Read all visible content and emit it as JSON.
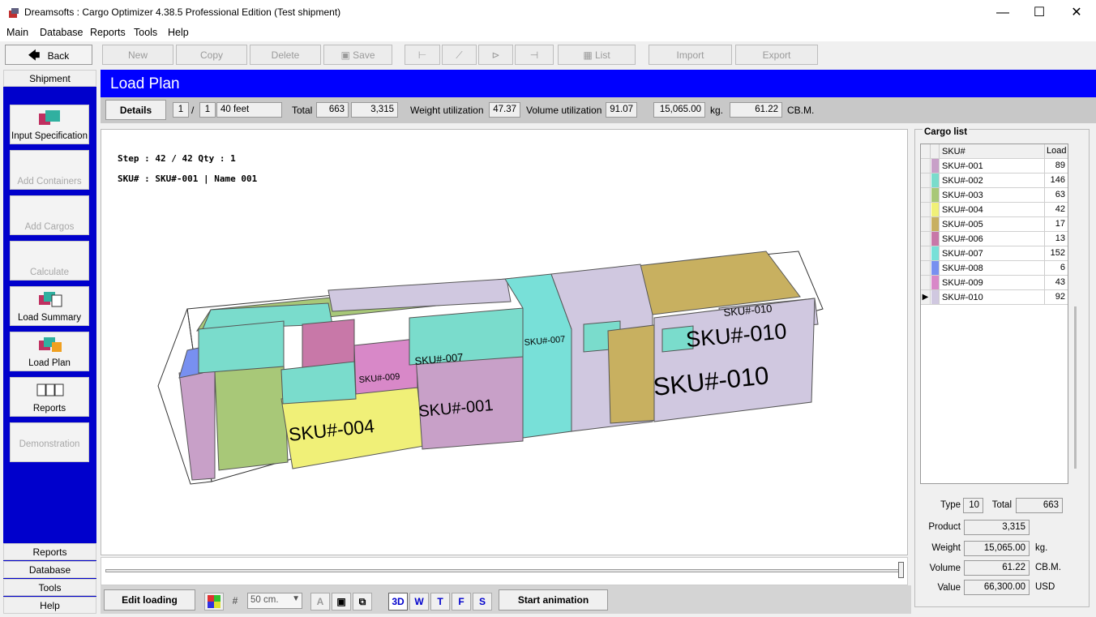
{
  "window": {
    "title": "Dreamsofts : Cargo Optimizer 4.38.5 Professional Edition  (Test shipment)",
    "minimize": "—",
    "maximize": "☐",
    "close": "✕"
  },
  "menu": [
    "Main",
    "Database",
    "Reports",
    "Tools",
    "Help"
  ],
  "toolbar": {
    "back": "Back",
    "new": "New",
    "copy": "Copy",
    "delete": "Delete",
    "save": "Save",
    "list": "List",
    "import": "Import",
    "export": "Export"
  },
  "nav": {
    "section": "Shipment",
    "buttons": [
      {
        "label": "Input Specification",
        "enabled": true
      },
      {
        "label": "Add Containers",
        "enabled": false
      },
      {
        "label": "Add Cargos",
        "enabled": false
      },
      {
        "label": "Calculate",
        "enabled": false
      },
      {
        "label": "Load Summary",
        "enabled": true
      },
      {
        "label": "Load Plan",
        "enabled": true
      },
      {
        "label": "Reports",
        "enabled": true
      },
      {
        "label": "Demonstration",
        "enabled": false
      }
    ],
    "footer": [
      "Reports",
      "Database",
      "Tools",
      "Help"
    ]
  },
  "page": {
    "title": "Load Plan",
    "details_button": "Details",
    "container_index": "1",
    "separator": "/",
    "container_count": "1",
    "container_type": "40 feet",
    "total_label": "Total",
    "total_qty": "663",
    "total_product": "3,315",
    "weight_util_label": "Weight utilization",
    "weight_util": "47.37",
    "volume_util_label": "Volume utilization",
    "volume_util": "91.07",
    "weight": "15,065.00",
    "weight_unit": "kg.",
    "volume": "61.22",
    "volume_unit": "CB.M."
  },
  "viewer": {
    "step_line": "Step : 42 / 42  Qty :  1",
    "sku_line": "SKU# : SKU#-001 | Name 001",
    "box_labels": [
      "SKU#-004",
      "SKU#-001",
      "SKU#-010",
      "SKU#-010",
      "SKU#-007",
      "SKU#-009",
      "SKU#-010",
      "SKU#-007"
    ]
  },
  "bottom": {
    "edit_loading": "Edit loading",
    "grid_size": "50 cm.",
    "view_3d": "3D",
    "view_w": "W",
    "view_t": "T",
    "view_f": "F",
    "view_s": "S",
    "start_animation": "Start animation"
  },
  "cargo_list": {
    "title": "Cargo list",
    "headers": {
      "sku": "SKU#",
      "load": "Load"
    },
    "rows": [
      {
        "sku": "SKU#-001",
        "load": "89",
        "color": "#c8a0c8"
      },
      {
        "sku": "SKU#-002",
        "load": "146",
        "color": "#7adccc"
      },
      {
        "sku": "SKU#-003",
        "load": "63",
        "color": "#a8c878"
      },
      {
        "sku": "SKU#-004",
        "load": "42",
        "color": "#f0f078"
      },
      {
        "sku": "SKU#-005",
        "load": "17",
        "color": "#c8b060"
      },
      {
        "sku": "SKU#-006",
        "load": "13",
        "color": "#c878a8"
      },
      {
        "sku": "SKU#-007",
        "load": "152",
        "color": "#78e0d8"
      },
      {
        "sku": "SKU#-008",
        "load": "6",
        "color": "#7890f0"
      },
      {
        "sku": "SKU#-009",
        "load": "43",
        "color": "#d888c8"
      },
      {
        "sku": "SKU#-010",
        "load": "92",
        "color": "#d0c8e0"
      }
    ],
    "selected_marker": "▶",
    "type_label": "Type",
    "type_value": "10",
    "total_label": "Total",
    "total_value": "663",
    "product_label": "Product",
    "product_value": "3,315",
    "weight_label": "Weight",
    "weight_value": "15,065.00",
    "weight_unit": "kg.",
    "volume_label": "Volume",
    "volume_value": "61.22",
    "volume_unit": "CB.M.",
    "value_label": "Value",
    "value_value": "66,300.00",
    "value_unit": "USD"
  }
}
